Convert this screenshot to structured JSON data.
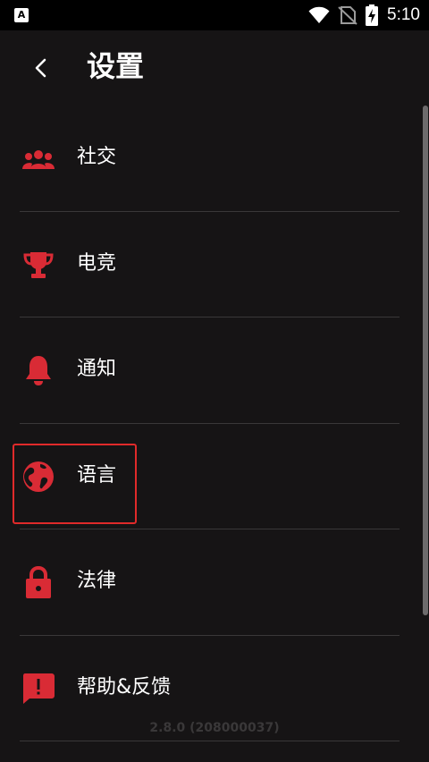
{
  "status_bar": {
    "left_icon_letter": "A",
    "time": "5:10",
    "icons": [
      "wifi-icon",
      "no-sim-icon",
      "battery-charging-icon"
    ]
  },
  "header": {
    "back_icon": "chevron-left-icon",
    "title": "设置"
  },
  "settings": [
    {
      "icon": "people-icon",
      "label": "社交"
    },
    {
      "icon": "trophy-icon",
      "label": "电竞"
    },
    {
      "icon": "bell-icon",
      "label": "通知"
    },
    {
      "icon": "globe-icon",
      "label": "语言",
      "highlighted": true
    },
    {
      "icon": "lock-icon",
      "label": "法律"
    },
    {
      "icon": "feedback-icon",
      "label": "帮助&反馈"
    }
  ],
  "version": "2.8.0 (208000037)",
  "colors": {
    "accent": "#d92b35",
    "background": "#161415",
    "highlight_border": "#e02a2a"
  }
}
